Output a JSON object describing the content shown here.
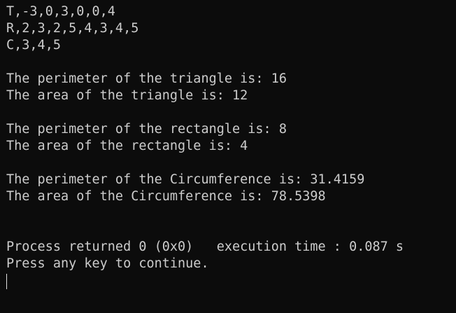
{
  "console": {
    "lines": [
      "T,-3,0,3,0,0,4",
      "R,2,3,2,5,4,3,4,5",
      "C,3,4,5",
      "",
      "The perimeter of the triangle is: 16",
      "The area of the triangle is: 12",
      "",
      "The perimeter of the rectangle is: 8",
      "The area of the rectangle is: 4",
      "",
      "The perimeter of the Circumference is: 31.4159",
      "The area of the Circumference is: 78.5398",
      "",
      "",
      "Process returned 0 (0x0)   execution time : 0.087 s",
      "Press any key to continue."
    ]
  },
  "colors": {
    "background": "#0c0c0c",
    "text": "#cccccc"
  }
}
